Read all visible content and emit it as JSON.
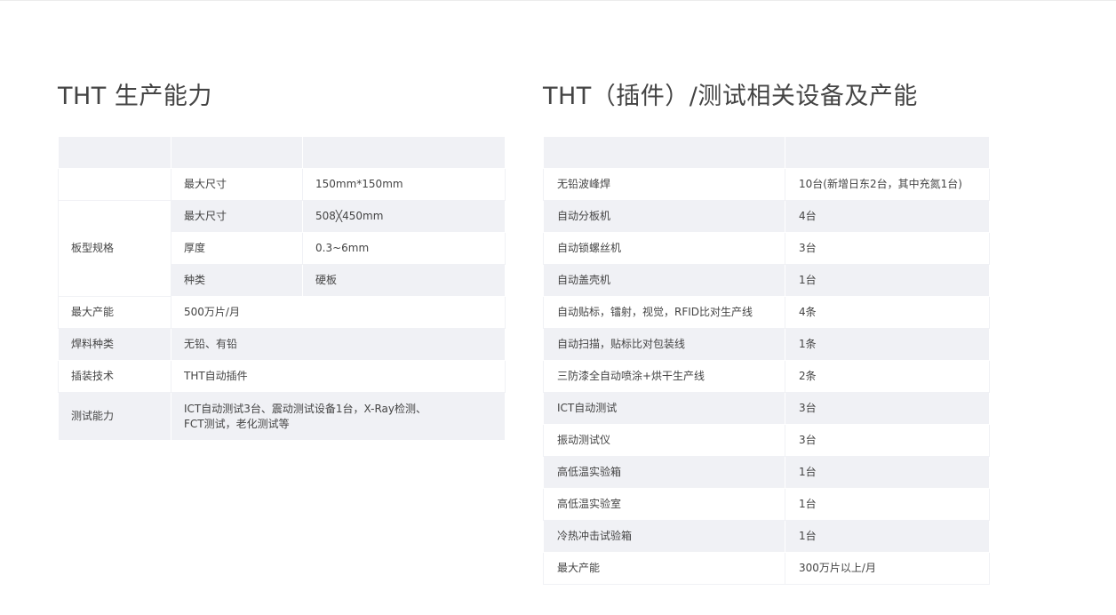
{
  "left_section": {
    "title": "THT 生产能力",
    "rows": [
      {
        "sub_label": "最大尺寸",
        "value": "150mm*150mm"
      },
      {
        "sub_label": "最大尺寸",
        "value": "508╳450mm"
      },
      {
        "sub_label": "厚度",
        "value": "0.3~6mm"
      },
      {
        "sub_label": "种类",
        "value": "硬板"
      }
    ],
    "group_label": "板型规格",
    "simple_rows": [
      {
        "label": "最大产能",
        "value": "500万片/月"
      },
      {
        "label": "焊料种类",
        "value": "无铅、有铅"
      },
      {
        "label": "插装技术",
        "value": "THT自动插件"
      },
      {
        "label": "测试能力",
        "value_line1": "ICT自动测试3台、震动测试设备1台，X-Ray检测、",
        "value_line2": "FCT测试，老化测试等"
      }
    ]
  },
  "right_section": {
    "title": "THT（插件）/测试相关设备及产能",
    "rows": [
      {
        "label": "无铅波峰焊",
        "value": "10台(新增日东2台，其中充氮1台)"
      },
      {
        "label": "自动分板机",
        "value": "4台"
      },
      {
        "label": "自动锁螺丝机",
        "value": "3台"
      },
      {
        "label": "自动盖壳机",
        "value": "1台"
      },
      {
        "label": "自动贴标，镭射，视觉，RFID比对生产线",
        "value": "4条"
      },
      {
        "label": "自动扫描，贴标比对包装线",
        "value": "1条"
      },
      {
        "label": "三防漆全自动喷涂+烘干生产线",
        "value": "2条"
      },
      {
        "label": "ICT自动测试",
        "value": "3台"
      },
      {
        "label": "振动测试仪",
        "value": "3台"
      },
      {
        "label": "高低温实验箱",
        "value": "1台"
      },
      {
        "label": "高低温实验室",
        "value": "1台"
      },
      {
        "label": "冷热冲击试验箱",
        "value": "1台"
      },
      {
        "label": "最大产能",
        "value": "300万片以上/月"
      }
    ]
  },
  "colors": {
    "header_bg": "#f0f1f5",
    "stripe_bg": "#f0f1f5",
    "text": "#444444"
  }
}
